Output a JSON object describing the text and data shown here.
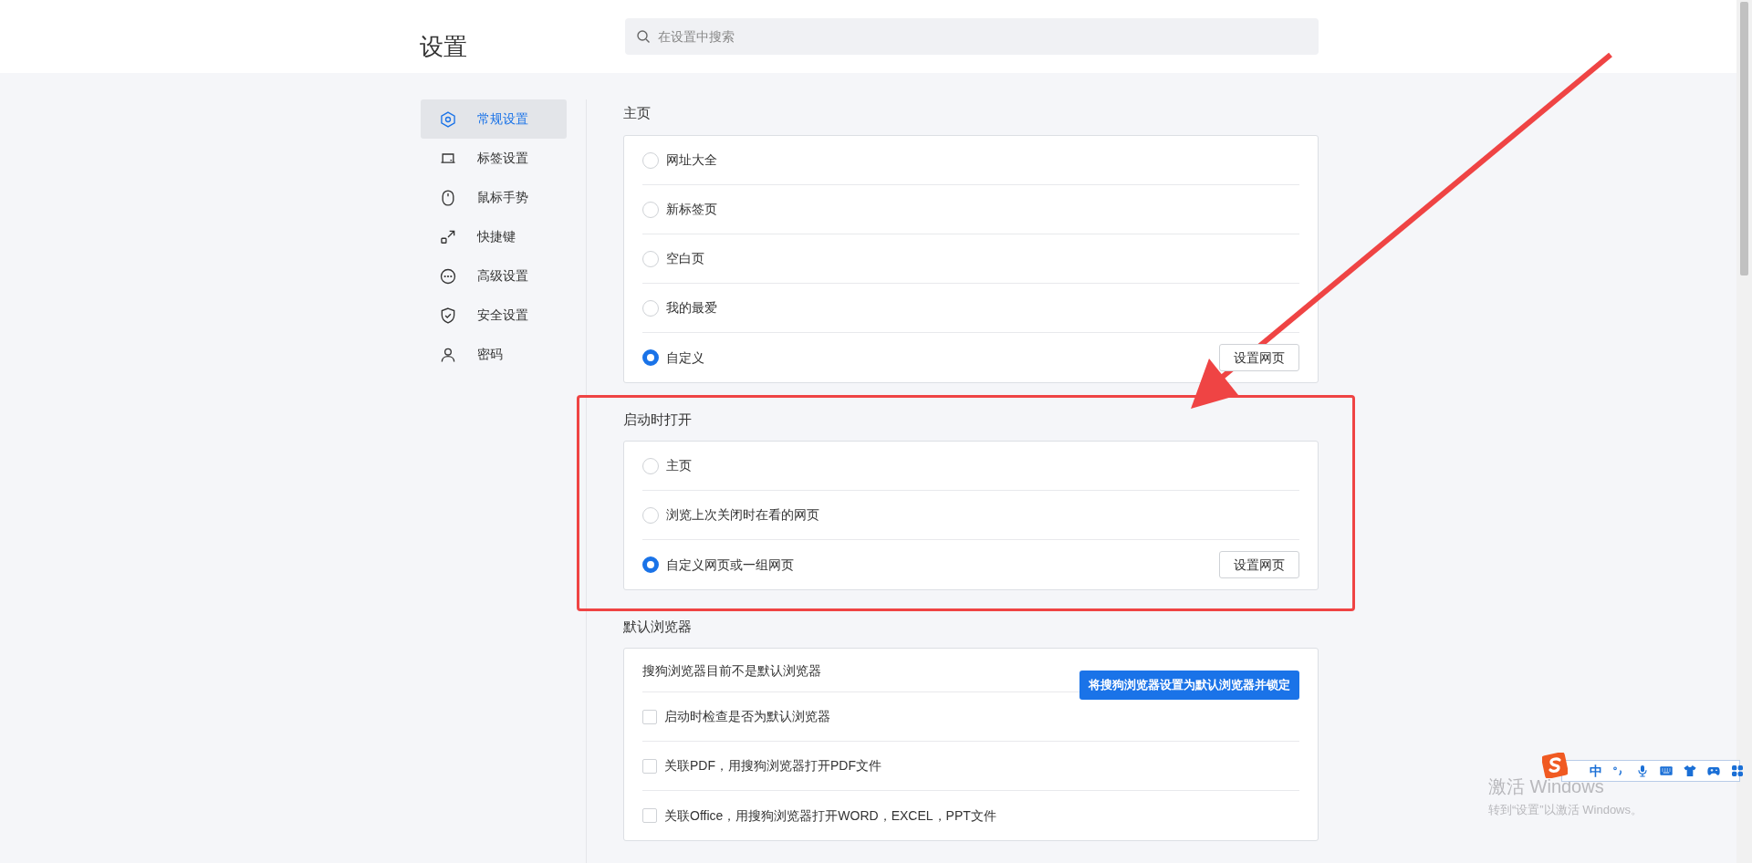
{
  "header": {
    "title": "设置",
    "search": {
      "placeholder": "在设置中搜索"
    }
  },
  "sidebar": {
    "items": [
      {
        "kind": "hexagon",
        "label": "常规设置",
        "selected": true
      },
      {
        "kind": "laptop",
        "label": "标签设置",
        "selected": false
      },
      {
        "kind": "mouse",
        "label": "鼠标手势",
        "selected": false
      },
      {
        "kind": "shortcut",
        "label": "快捷键",
        "selected": false
      },
      {
        "kind": "dots",
        "label": "高级设置",
        "selected": false
      },
      {
        "kind": "shield",
        "label": "安全设置",
        "selected": false
      },
      {
        "kind": "user",
        "label": "密码",
        "selected": false
      }
    ]
  },
  "sections": [
    {
      "heading": "主页",
      "rows": [
        {
          "kind": "radio",
          "label": "网址大全",
          "selected": false
        },
        {
          "kind": "radio",
          "label": "新标签页",
          "selected": false
        },
        {
          "kind": "radio",
          "label": "空白页",
          "selected": false
        },
        {
          "kind": "radio",
          "label": "我的最爱",
          "selected": false
        },
        {
          "kind": "radio",
          "label": "自定义",
          "selected": true,
          "button": "设置网页"
        }
      ]
    },
    {
      "heading": "启动时打开",
      "rows": [
        {
          "kind": "radio",
          "label": "主页",
          "selected": false
        },
        {
          "kind": "radio",
          "label": "浏览上次关闭时在看的网页",
          "selected": false
        },
        {
          "kind": "radio",
          "label": "自定义网页或一组网页",
          "selected": true,
          "button": "设置网页"
        }
      ]
    },
    {
      "heading": "默认浏览器",
      "rows": [
        {
          "kind": "status",
          "label": "搜狗浏览器目前不是默认浏览器",
          "primary_button": "将搜狗浏览器设置为默认浏览器并锁定"
        },
        {
          "kind": "checkbox",
          "label": "启动时检查是否为默认浏览器",
          "checked": false
        },
        {
          "kind": "checkbox",
          "label": "关联PDF，用搜狗浏览器打开PDF文件",
          "checked": false
        },
        {
          "kind": "checkbox",
          "label": "关联Office，用搜狗浏览器打开WORD，EXCEL，PPT文件",
          "checked": false
        }
      ]
    }
  ],
  "annotations": {
    "arrow": {
      "color": "#ef4444"
    },
    "highlight_box": {
      "color": "#ef4444"
    }
  },
  "watermark": {
    "title": "激活 Windows",
    "subtitle": "转到“设置”以激活 Windows。"
  },
  "ime_toolbar": {
    "items": [
      {
        "kind": "logo"
      },
      {
        "kind": "text",
        "label": "中"
      },
      {
        "kind": "punct"
      },
      {
        "kind": "mic"
      },
      {
        "kind": "keyboard"
      },
      {
        "kind": "shirt"
      },
      {
        "kind": "gamepad"
      },
      {
        "kind": "grid"
      }
    ]
  }
}
